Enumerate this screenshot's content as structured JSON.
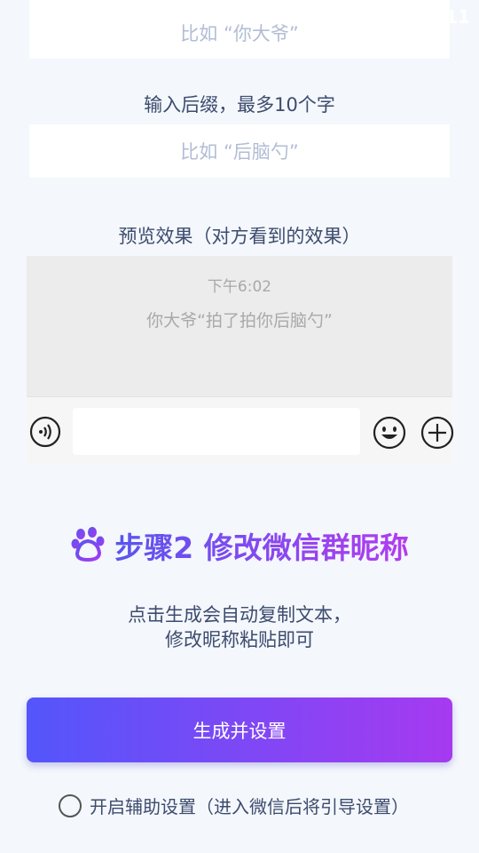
{
  "status_bar": {
    "time": "4:11"
  },
  "prefix": {
    "placeholder": "比如 “你大爷”"
  },
  "suffix": {
    "label": "输入后缀，最多10个字",
    "placeholder": "比如 “后脑勺”"
  },
  "preview": {
    "label": "预览效果（对方看到的效果）",
    "time": "下午6:02",
    "message": "你大爷“拍了拍你后脑勺”"
  },
  "step2": {
    "title": "步骤2 修改微信群昵称",
    "desc_line1": "点击生成会自动复制文本，",
    "desc_line2": "修改昵称粘贴即可"
  },
  "generate_button": {
    "label": "生成并设置"
  },
  "assist_option": {
    "label": "开启辅助设置（进入微信后将引导设置）"
  },
  "icons": {
    "wifi": "wifi-icon",
    "signal": "signal-icon",
    "battery": "battery-icon",
    "voice": "voice-icon",
    "emoji": "emoji-icon",
    "plus": "plus-icon",
    "paw": "paw-icon"
  },
  "colors": {
    "background": "#f4f7fc",
    "accent_start": "#5356fb",
    "accent_end": "#a63af0",
    "label_text": "#3d4c6e",
    "placeholder_text": "#b2bdd4"
  }
}
